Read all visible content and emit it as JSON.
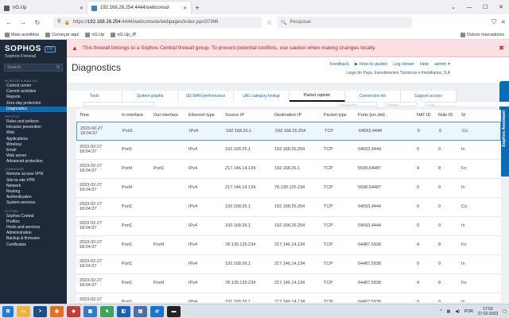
{
  "browser": {
    "tabs": [
      {
        "label": "nG.Up"
      },
      {
        "label": "192.168.26.254:4444/webconsol"
      }
    ],
    "url_host": "192.168.26.254",
    "url_rest": ":4444/webconsole/webpages/index.jsp#37996",
    "url_scheme": "https://",
    "search_placeholder": "Pesquisar",
    "bookmarks": [
      "Mais acedidos",
      "Começar aqui",
      "nG.Up",
      "nG.Up_IP"
    ],
    "bookmarks_right": "Outros marcadores"
  },
  "sidebar": {
    "logo": "SOPHOS",
    "logo_badge": "FW",
    "subtitle": "Sophos Firewall",
    "search_placeholder": "Search",
    "sections": [
      {
        "title": "MONITOR & ANALYZE",
        "items": [
          "Control center",
          "Current activities",
          "Reports",
          "Zero-day protection",
          "Diagnostics"
        ]
      },
      {
        "title": "PROTECT",
        "items": [
          "Rules and policies",
          "Intrusion prevention",
          "Web",
          "Applications",
          "Wireless",
          "Email",
          "Web server",
          "Advanced protection"
        ]
      },
      {
        "title": "CONFIGURE",
        "items": [
          "Remote access VPN",
          "Site-to-site VPN",
          "Network",
          "Routing",
          "Authentication",
          "System services"
        ]
      },
      {
        "title": "SYSTEM",
        "items": [
          "Sophos Central",
          "Profiles",
          "Hosts and services",
          "Administration",
          "Backup & firmware",
          "Certificates"
        ]
      }
    ]
  },
  "alert": {
    "text": "This firewall belongs to a Sophos Central firewall group. To prevent potential conflicts, use caution when making changes locally."
  },
  "page": {
    "title": "Diagnostics",
    "links": [
      "Feedback",
      "How-to guides",
      "Log viewer",
      "Help",
      "admin"
    ],
    "org": "Largo do Paço, Investimentos Turísticos e Imobiliários, S.A",
    "assistant": "Sophos Assistant"
  },
  "tabs": [
    "Tools",
    "System graphs",
    "SD-WAN performance",
    "URL category lookup",
    "Packet capture",
    "Connection list",
    "Support access"
  ],
  "toolbar": {
    "filter": "",
    "display_filter": "Display filter",
    "refresh": "Refresh",
    "clear": "Clear"
  },
  "table": {
    "headers": [
      "Time",
      "In interface",
      "Out interface",
      "Ethernet type",
      "Source IP",
      "Destination IP",
      "Packet type",
      "Ports [src,dst]",
      "NAT ID",
      "Rule ID",
      "St"
    ],
    "rows": [
      {
        "date": "2023-02-27",
        "time": "18:04:37",
        "in": "Port1",
        "out": "",
        "eth": "IPv4",
        "src": "192.168.26.1",
        "dst": "192.168.26.254",
        "type": "TCP",
        "ports": "64593,4444",
        "nat": "0",
        "rule": "0",
        "st": "Co"
      },
      {
        "date": "2023-02-27",
        "time": "18:04:37",
        "in": "Port1",
        "out": "",
        "eth": "IPv4",
        "src": "192.168.26.1",
        "dst": "192.168.26.254",
        "type": "TCP",
        "ports": "64593,4444",
        "nat": "0",
        "rule": "0",
        "st": "In"
      },
      {
        "date": "2023-02-27",
        "time": "18:04:37",
        "in": "Port4",
        "out": "Port1",
        "eth": "IPv4",
        "src": "217.146.14.134",
        "dst": "192.168.26.1",
        "type": "TCP",
        "ports": "5938,64487",
        "nat": "4",
        "rule": "8",
        "st": "Fo"
      },
      {
        "date": "2023-02-27",
        "time": "18:04:37",
        "in": "Port4",
        "out": "",
        "eth": "IPv4",
        "src": "217.146.14.134",
        "dst": "78.130.125.234",
        "type": "TCP",
        "ports": "5938,64487",
        "nat": "0",
        "rule": "0",
        "st": "In"
      },
      {
        "date": "2023-02-27",
        "time": "18:04:37",
        "in": "Port1",
        "out": "",
        "eth": "IPv4",
        "src": "192.168.26.1",
        "dst": "192.168.26.254",
        "type": "TCP",
        "ports": "64593,4444",
        "nat": "0",
        "rule": "0",
        "st": "Co"
      },
      {
        "date": "2023-02-27",
        "time": "18:04:37",
        "in": "Port1",
        "out": "",
        "eth": "IPv4",
        "src": "192.168.26.1",
        "dst": "192.168.26.254",
        "type": "TCP",
        "ports": "64593,4444",
        "nat": "0",
        "rule": "0",
        "st": "In"
      },
      {
        "date": "2023-02-27",
        "time": "18:04:37",
        "in": "Port1",
        "out": "Port4",
        "eth": "IPv4",
        "src": "78.130.125.234",
        "dst": "217.146.14.134",
        "type": "TCP",
        "ports": "64487,5938",
        "nat": "4",
        "rule": "8",
        "st": "Fo"
      },
      {
        "date": "2023-02-27",
        "time": "18:04:37",
        "in": "Port1",
        "out": "",
        "eth": "IPv4",
        "src": "192.168.26.1",
        "dst": "217.146.14.134",
        "type": "TCP",
        "ports": "64487,5938",
        "nat": "0",
        "rule": "0",
        "st": "In"
      },
      {
        "date": "2023-02-27",
        "time": "18:04:37",
        "in": "Port1",
        "out": "Port4",
        "eth": "IPv4",
        "src": "78.130.125.234",
        "dst": "217.146.14.134",
        "type": "TCP",
        "ports": "64487,5938",
        "nat": "4",
        "rule": "8",
        "st": "Fo"
      },
      {
        "date": "2023-02-27",
        "time": "18:04:37",
        "in": "Port1",
        "out": "",
        "eth": "IPv4",
        "src": "192.168.26.1",
        "dst": "217.146.14.134",
        "type": "TCP",
        "ports": "64487,5938",
        "nat": "0",
        "rule": "0",
        "st": "In"
      }
    ]
  },
  "taskbar": {
    "lang": "POR",
    "time": "17:55",
    "date": "27-02-2023"
  }
}
